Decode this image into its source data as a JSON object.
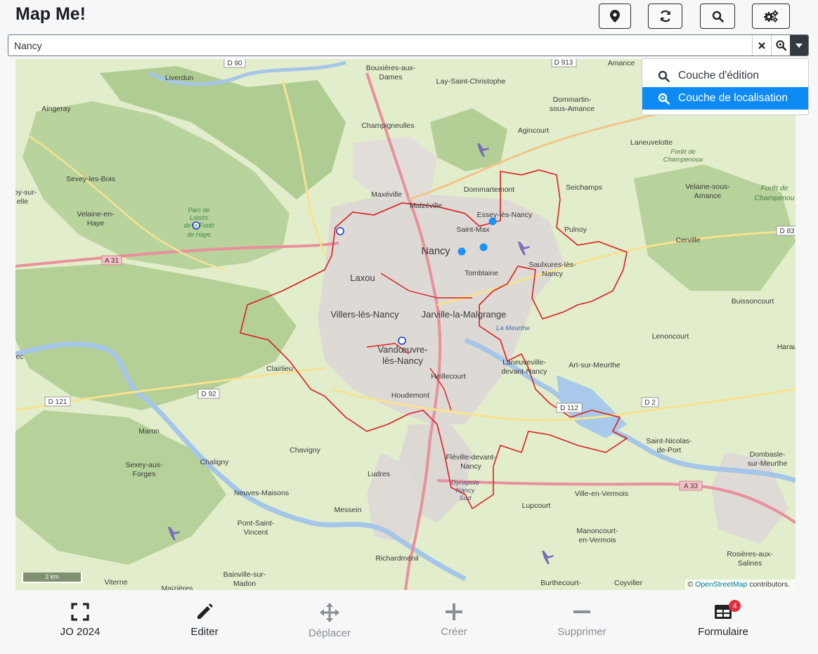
{
  "app": {
    "title": "Map Me!"
  },
  "toolbar": {
    "buttons": [
      {
        "name": "location",
        "icon": "map-marker-icon"
      },
      {
        "name": "refresh",
        "icon": "refresh-icon"
      },
      {
        "name": "search",
        "icon": "search-icon"
      },
      {
        "name": "settings",
        "icon": "gears-icon"
      }
    ]
  },
  "search": {
    "value": "Nancy"
  },
  "layer_menu": {
    "items": [
      {
        "label": "Couche d'édition",
        "icon": "search-icon",
        "active": false
      },
      {
        "label": "Couche de localisation",
        "icon": "search-location-icon",
        "active": true
      }
    ],
    "active_color": "#0d8af3"
  },
  "map": {
    "labels": {
      "nancy": "Nancy",
      "laxou": "Laxou",
      "villers": "Villers-lès-Nancy",
      "jarville": "Jarville-la-Malgrange",
      "vandoeuvre1": "Vandœuvre-",
      "vandoeuvre2": "lès-Nancy",
      "maxeville": "Maxéville",
      "malzeville": "Malzéville",
      "essey": "Essey-lès-Nancy",
      "saintmax": "Saint-Max",
      "tomblaine": "Tomblaine",
      "dommartemont": "Dommartemont",
      "seichamps": "Seichamps",
      "pulnoy": "Pulnoy",
      "saulxures1": "Saulxures-lès-",
      "saulxures2": "Nancy",
      "champigneulles": "Champigneulles",
      "bouxieres1": "Bouxières-aux-",
      "bouxieres2": "Dames",
      "lay": "Lay-Saint-Christophe",
      "dommartin1": "Dommartin-",
      "dommartin2": "sous-Amance",
      "agincourt": "Agincourt",
      "laneuvelotte": "Laneuvelotte",
      "velaine_amance1": "Velaine-sous-",
      "velaine_amance2": "Amance",
      "cerville": "Cerville",
      "buissoncourt": "Buissoncourt",
      "lenoncourt": "Lenoncourt",
      "art": "Art-sur-Meurthe",
      "laneuveville1": "Laneuveville-",
      "laneuveville2": "devant-Nancy",
      "heillecourt": "Heillecourt",
      "houdemont": "Houdemont",
      "fleville1": "Fléville-devant-",
      "fleville2": "Nancy",
      "ludres": "Ludres",
      "chavigny": "Chavigny",
      "chaligny": "Chaligny",
      "maron": "Maron",
      "sexey_forges1": "Sexey-aux-",
      "sexey_forges2": "Forges",
      "neuves": "Neuves-Maisons",
      "messein": "Messein",
      "pont1": "Pont-Saint-",
      "pont2": "Vincent",
      "richardmenil": "Richardménil",
      "bainville1": "Bainville-sur-",
      "bainville2": "Madon",
      "viterne": "Viterne",
      "maiziers": "Maizières",
      "clairlieu": "Clairlieu",
      "liverdun": "Liverdun",
      "aingeray": "Aingeray",
      "sexey_bois": "Sexey-les-Bois",
      "velaine_haye1": "Velaine-en-",
      "velaine_haye2": "Haye",
      "parc1": "Parc de",
      "parc2": "Loisirs",
      "parc3": "de la Forêt",
      "parc4": "de Haye",
      "ville_vermois": "Ville-en-Vermois",
      "lupcourt": "Lupcourt",
      "manoncourt1": "Manoncourt-",
      "manoncourt2": "en-Vermois",
      "burthecourt": "Burthecourt-",
      "coyviller": "Coyviller",
      "saint_nicolas1": "Saint-Nicolas-",
      "saint_nicolas2": "de-Port",
      "dombasle1": "Dombasle-",
      "dombasle2": "sur-Meurthe",
      "rosieres1": "Rosières-aux-",
      "rosieres2": "Salines",
      "amance": "Amance",
      "foret_champ1": "Forêt de",
      "foret_champ2": "Champenoux",
      "foret_champ3": "Forêt de",
      "foret_champ4": "Champenou",
      "harau": "Harau",
      "dynapole1": "Dynapole",
      "dynapole2": "Nancy",
      "dynapole3": "Sud",
      "meurthe": "La Meurthe",
      "edge_ec": "ec",
      "edge_oy1": "oy-sur-",
      "edge_oy2": "elle"
    },
    "roads": [
      "D 90",
      "D 913",
      "A 31",
      "D 92",
      "D 121",
      "D 112",
      "D 2",
      "A 33",
      "D 83"
    ],
    "attribution_prefix": "© ",
    "attribution_link": "OpenStreetMap",
    "attribution_suffix": " contributors.",
    "scale": "2 km",
    "boundary_color": "#dd1f1f",
    "marker_color": "#1e90ff"
  },
  "bottom": {
    "items": [
      {
        "label": "JO 2024",
        "icon": "expand-icon",
        "enabled": true
      },
      {
        "label": "Editer",
        "icon": "pencil-icon",
        "enabled": true
      },
      {
        "label": "Déplacer",
        "icon": "move-icon",
        "enabled": false
      },
      {
        "label": "Créer",
        "icon": "plus-icon",
        "enabled": false
      },
      {
        "label": "Supprimer",
        "icon": "minus-icon",
        "enabled": false
      },
      {
        "label": "Formulaire",
        "icon": "table-icon",
        "enabled": true,
        "badge": "4"
      }
    ]
  }
}
